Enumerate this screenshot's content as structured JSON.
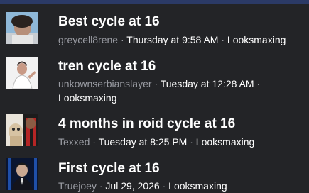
{
  "colors": {
    "background": "#232427",
    "header_bar": "#2b3a66",
    "author_text": "#9a9ca3",
    "title_text": "#ffffff"
  },
  "separator": "·",
  "threads": [
    {
      "title": "Best cycle at 16",
      "author": "greycell8rene",
      "date": "Thursday at 9:58 AM",
      "forum": "Looksmaxing",
      "avatar_icon": "avatar-photo-icon"
    },
    {
      "title": "tren cycle at 16",
      "author": "unkownserbianslayer",
      "date": "Tuesday at 12:28 AM",
      "forum": "Looksmaxing",
      "avatar_icon": "avatar-photo-icon"
    },
    {
      "title": "4 months in roid cycle at 16",
      "author": "Texxed",
      "date": "Tuesday at 8:25 PM",
      "forum": "Looksmaxing",
      "avatar_icon": "avatar-photo-icon"
    },
    {
      "title": "First cycle at 16",
      "author": "Truejoey",
      "date": "Jul 29, 2026",
      "forum": "Looksmaxing",
      "avatar_icon": "avatar-photo-icon"
    }
  ]
}
